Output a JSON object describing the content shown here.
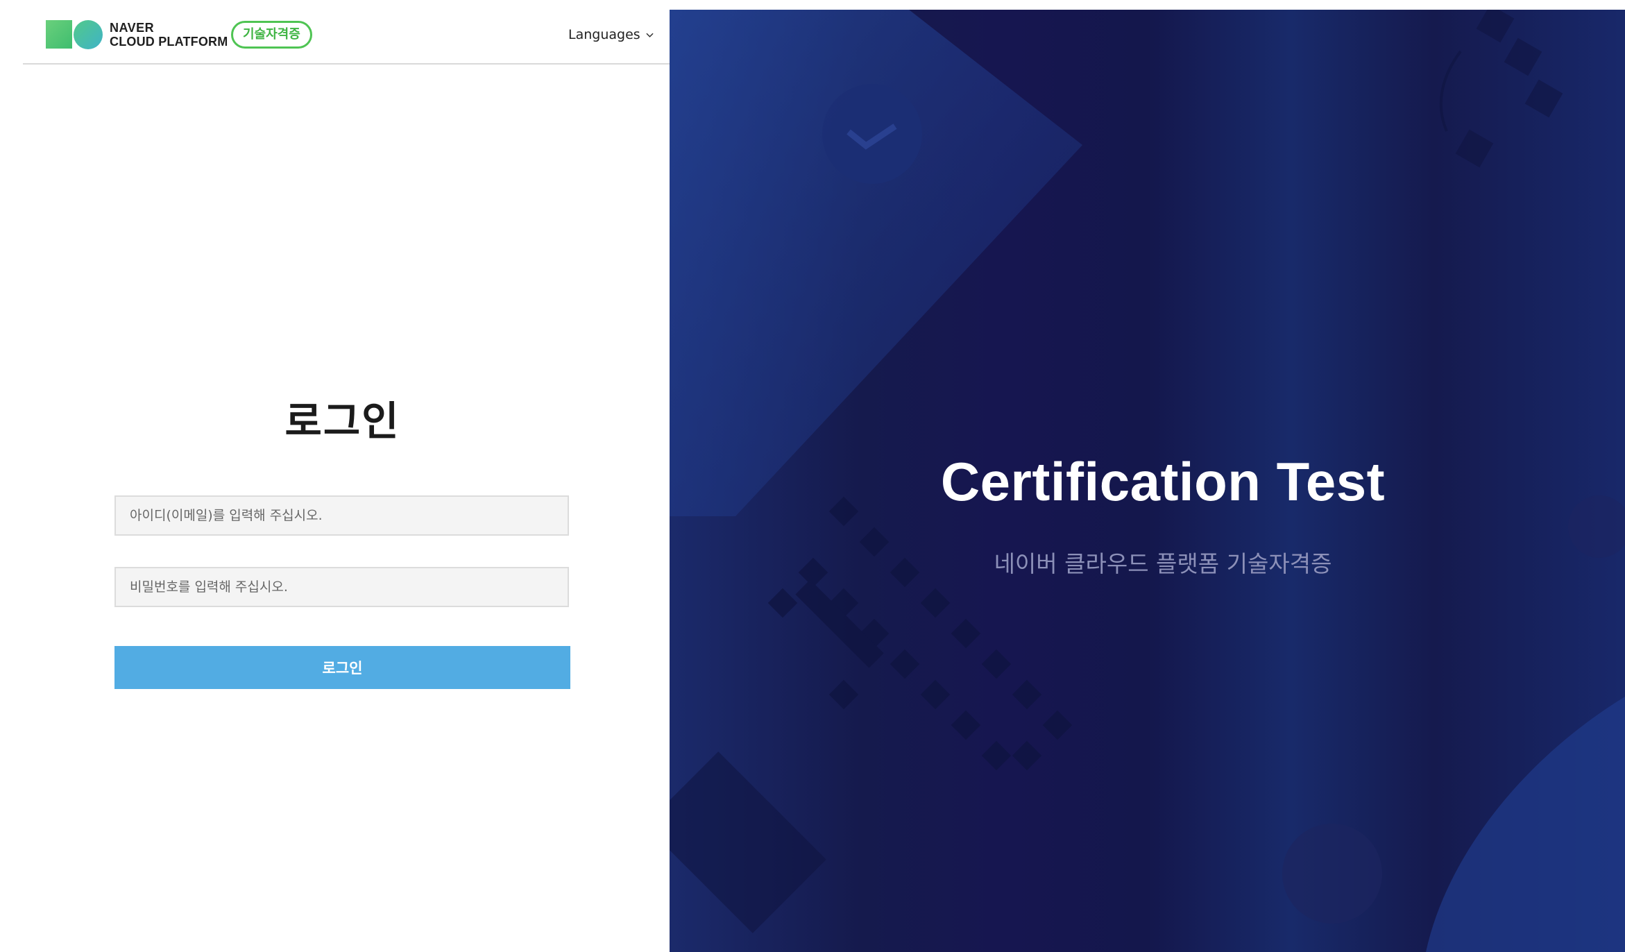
{
  "header": {
    "brand_line1": "NAVER",
    "brand_line2": "CLOUD PLATFORM",
    "badge": "기술자격증",
    "languages_label": "Languages"
  },
  "login": {
    "title": "로그인",
    "id_placeholder": "아이디(이메일)를 입력해 주십시오.",
    "password_placeholder": "비밀번호를 입력해 주십시오.",
    "submit_label": "로그인"
  },
  "hero": {
    "title": "Certification Test",
    "subtitle": "네이버 클라우드 플랫폼 기술자격증"
  },
  "colors": {
    "badge_green": "#4fc453",
    "button_blue": "#52ace3",
    "hero_bg": "#161650"
  }
}
